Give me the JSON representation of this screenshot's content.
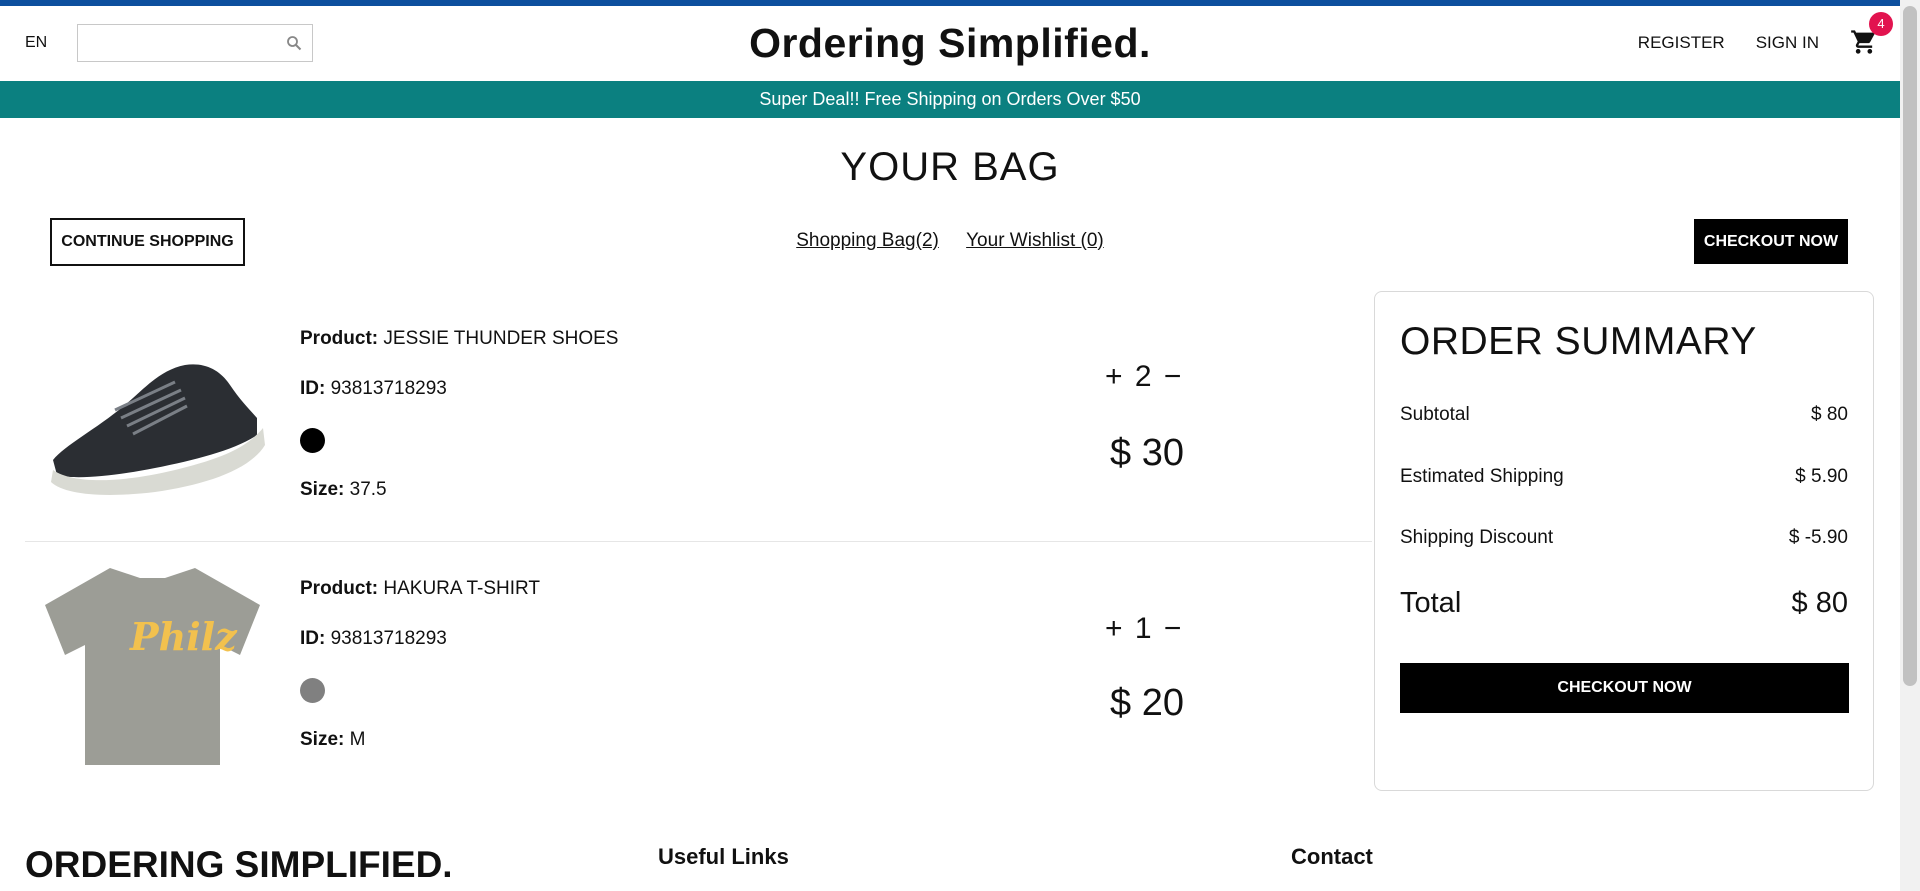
{
  "header": {
    "language": "EN",
    "search": {
      "placeholder": "",
      "value": ""
    },
    "brand": "Ordering Simplified.",
    "register": "REGISTER",
    "sign_in": "SIGN IN",
    "cart_count": "4"
  },
  "announcement": "Super Deal!! Free Shipping on Orders Over $50",
  "page_title": "YOUR BAG",
  "top_bar": {
    "continue_label": "CONTINUE SHOPPING",
    "bag_link": "Shopping Bag(2)",
    "wishlist_link": "Your Wishlist (0)",
    "checkout_label": "CHECKOUT NOW"
  },
  "labels": {
    "product": "Product:",
    "id": "ID:",
    "size": "Size:"
  },
  "items": [
    {
      "product": "JESSIE THUNDER SHOES",
      "id": "93813718293",
      "color": "#000000",
      "size": "37.5",
      "plus": "+",
      "qty": "2",
      "minus": "−",
      "price": "$ 30"
    },
    {
      "product": "HAKURA T-SHIRT",
      "id": "93813718293",
      "color": "#808080",
      "size": "M",
      "plus": "+",
      "qty": "1",
      "minus": "−",
      "price": "$ 20"
    }
  ],
  "summary": {
    "title": "ORDER SUMMARY",
    "subtotal_label": "Subtotal",
    "subtotal": "$ 80",
    "shipping_label": "Estimated Shipping",
    "shipping": "$ 5.90",
    "discount_label": "Shipping Discount",
    "discount": "$ -5.90",
    "total_label": "Total",
    "total": "$ 80",
    "checkout_label": "CHECKOUT NOW"
  },
  "footer": {
    "brand": "ORDERING SIMPLIFIED.",
    "useful_links": "Useful Links",
    "contact": "Contact"
  },
  "colors": {
    "accent_bar": "#0d4f9e",
    "announcement_bg": "#0b8080",
    "badge": "#e2134f"
  }
}
